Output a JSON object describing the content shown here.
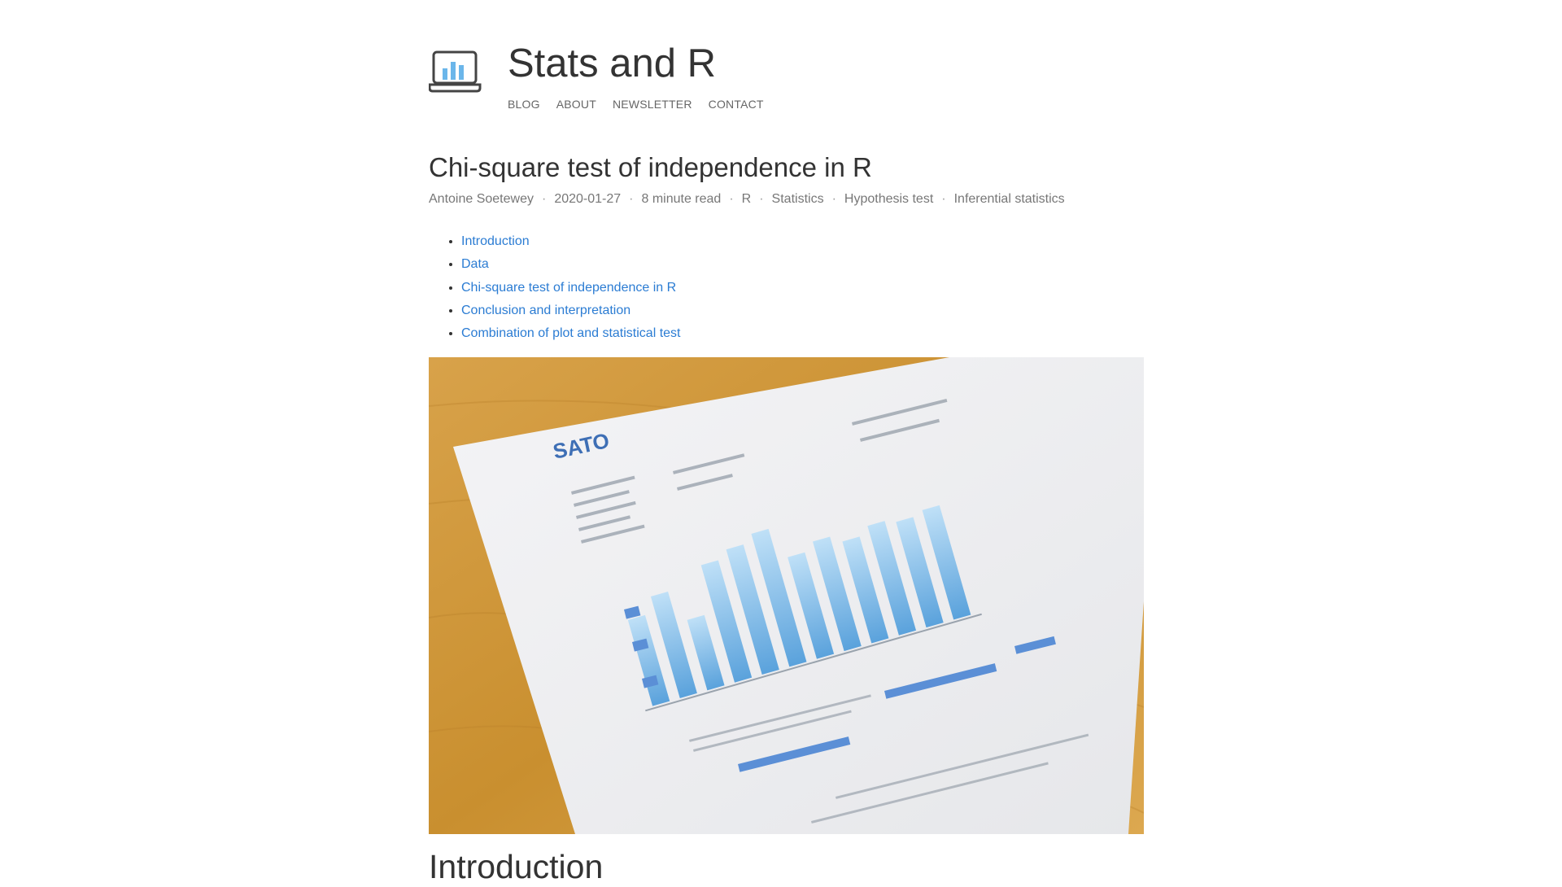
{
  "site": {
    "title": "Stats and R",
    "nav": [
      "BLOG",
      "ABOUT",
      "NEWSLETTER",
      "CONTACT"
    ]
  },
  "post": {
    "title": "Chi-square test of independence in R",
    "meta": {
      "author": "Antoine Soetewey",
      "date": "2020-01-27",
      "read_time": "8 minute read",
      "tags": [
        "R",
        "Statistics",
        "Hypothesis test",
        "Inferential statistics"
      ],
      "separator": "·"
    },
    "toc": [
      "Introduction",
      "Data",
      "Chi-square test of independence in R",
      "Conclusion and interpretation",
      "Combination of plot and statistical test"
    ],
    "hero_image": {
      "doc_brand": "SATO"
    },
    "first_section_title": "Introduction"
  },
  "colors": {
    "link": "#2b7cd3",
    "text": "#333333",
    "muted": "#777777",
    "logo_bars": "#6bb6ea",
    "wood": "#d49a3a"
  }
}
